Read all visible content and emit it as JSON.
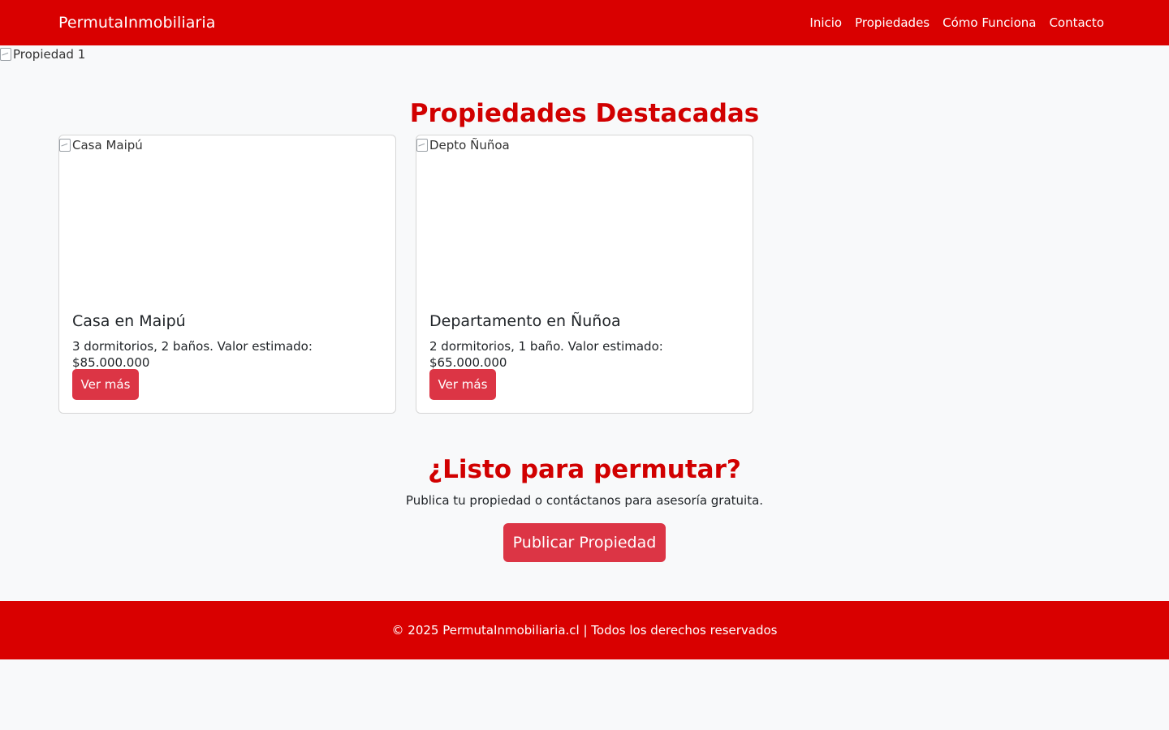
{
  "navbar": {
    "brand": "PermutaInmobiliaria",
    "links": [
      "Inicio",
      "Propiedades",
      "Cómo Funciona",
      "Contacto"
    ]
  },
  "hero": {
    "image_alt": "Propiedad 1"
  },
  "featured": {
    "title": "Propiedades Destacadas",
    "cards": [
      {
        "image_alt": "Casa Maipú",
        "title": "Casa en Maipú",
        "text": "3 dormitorios, 2 baños. Valor estimado: $85.000.000",
        "button": "Ver más"
      },
      {
        "image_alt": "Depto Ñuñoa",
        "title": "Departamento en Ñuñoa",
        "text": "2 dormitorios, 1 baño. Valor estimado: $65.000.000",
        "button": "Ver más"
      }
    ]
  },
  "cta": {
    "title": "¿Listo para permutar?",
    "text": "Publica tu propiedad o contáctanos para asesoría gratuita.",
    "button": "Publicar Propiedad"
  },
  "footer": {
    "text": "© 2025 PermutaInmobiliaria.cl | Todos los derechos reservados"
  },
  "colors": {
    "brand_red": "#d90000",
    "heading_red": "#d10000",
    "button_red": "#dc3545",
    "background": "#f8f9fa"
  }
}
